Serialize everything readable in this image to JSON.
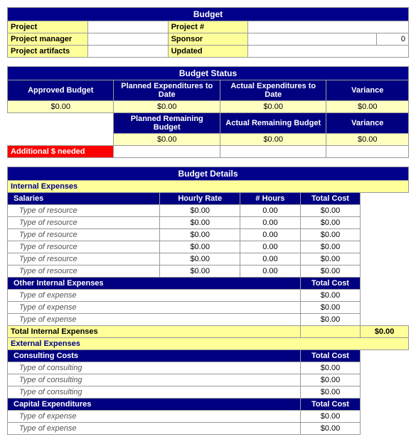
{
  "budget": {
    "title": "Budget",
    "fields": {
      "project_label": "Project",
      "project_hash_label": "Project #",
      "project_manager_label": "Project manager",
      "sponsor_label": "Sponsor",
      "sponsor_value": "0",
      "project_artifacts_label": "Project artifacts",
      "updated_label": "Updated"
    }
  },
  "budget_status": {
    "title": "Budget Status",
    "col_approved": "Approved Budget",
    "col_planned": "Planned Expenditures to Date",
    "col_actual": "Actual Expenditures to Date",
    "col_variance": "Variance",
    "col_planned_remaining": "Planned Remaining Budget",
    "col_actual_remaining": "Actual Remaining Budget",
    "row1": {
      "approved": "$0.00",
      "planned": "$0.00",
      "actual": "$0.00",
      "variance": "$0.00"
    },
    "row2": {
      "planned_remaining": "$0.00",
      "actual_remaining": "$0.00",
      "variance": "$0.00"
    },
    "additional_needed": "Additional $ needed"
  },
  "budget_details": {
    "title": "Budget Details",
    "internal_expenses_label": "Internal Expenses",
    "salaries_label": "Salaries",
    "col_hourly": "Hourly Rate",
    "col_hours": "# Hours",
    "col_total": "Total Cost",
    "salaries_rows": [
      {
        "type": "Type of resource",
        "hourly": "$0.00",
        "hours": "0.00",
        "total": "$0.00"
      },
      {
        "type": "Type of resource",
        "hourly": "$0.00",
        "hours": "0.00",
        "total": "$0.00"
      },
      {
        "type": "Type of resource",
        "hourly": "$0.00",
        "hours": "0.00",
        "total": "$0.00"
      },
      {
        "type": "Type of resource",
        "hourly": "$0.00",
        "hours": "0.00",
        "total": "$0.00"
      },
      {
        "type": "Type of resource",
        "hourly": "$0.00",
        "hours": "0.00",
        "total": "$0.00"
      },
      {
        "type": "Type of resource",
        "hourly": "$0.00",
        "hours": "0.00",
        "total": "$0.00"
      }
    ],
    "other_internal_label": "Other Internal Expenses",
    "other_total_col": "Total Cost",
    "other_rows": [
      {
        "type": "Type of expense",
        "total": "$0.00"
      },
      {
        "type": "Type of expense",
        "total": "$0.00"
      },
      {
        "type": "Type of expense",
        "total": "$0.00"
      }
    ],
    "total_internal_label": "Total Internal Expenses",
    "total_internal_value": "$0.00",
    "external_expenses_label": "External Expenses",
    "consulting_label": "Consulting Costs",
    "consulting_total_col": "Total Cost",
    "consulting_rows": [
      {
        "type": "Type of consulting",
        "total": "$0.00"
      },
      {
        "type": "Type of consulting",
        "total": "$0.00"
      },
      {
        "type": "Type of consulting",
        "total": "$0.00"
      }
    ],
    "capital_label": "Capital Expenditures",
    "capital_total_col": "Total Cost",
    "capital_rows": [
      {
        "type": "Type of expense",
        "total": "$0.00"
      },
      {
        "type": "Type of expense",
        "total": "$0.00"
      }
    ]
  }
}
